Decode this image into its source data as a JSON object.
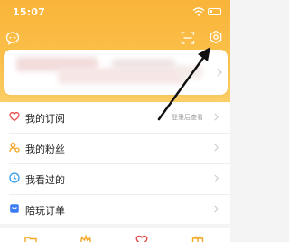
{
  "status_bar": {
    "time": "15:07"
  },
  "menu": {
    "items": [
      {
        "label": "我的订阅",
        "icon": "heart-icon",
        "color": "#e94a4a",
        "sub_label": "登录后查看"
      },
      {
        "label": "我的粉丝",
        "icon": "fans-icon",
        "color": "#f5a623"
      },
      {
        "label": "我看过的",
        "icon": "clock-icon",
        "color": "#2d9cf0"
      },
      {
        "label": "陪玩订单",
        "icon": "order-icon",
        "color": "#3d7bf2"
      }
    ]
  },
  "colors": {
    "header": "#fbbd44",
    "annotation_arrow": "#111111"
  }
}
